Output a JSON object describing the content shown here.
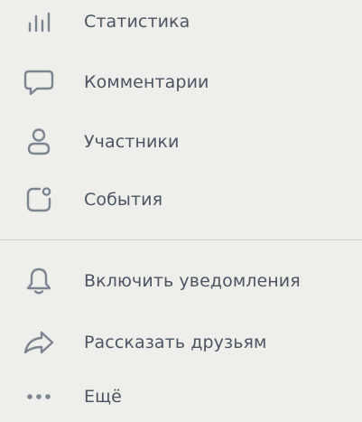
{
  "menu": {
    "items": [
      {
        "label": "Статистика",
        "icon": "bar-chart-icon"
      },
      {
        "label": "Комментарии",
        "icon": "comment-icon"
      },
      {
        "label": "Участники",
        "icon": "person-icon"
      },
      {
        "label": "События",
        "icon": "event-icon"
      }
    ],
    "actions": [
      {
        "label": "Включить уведомления",
        "icon": "bell-icon"
      },
      {
        "label": "Рассказать друзьям",
        "icon": "share-icon"
      },
      {
        "label": "Ещё",
        "icon": "more-icon"
      }
    ]
  },
  "colors": {
    "background": "#eeeeea",
    "icon": "#7c8591",
    "text": "#4b5563",
    "divider": "#d2d3d1"
  }
}
